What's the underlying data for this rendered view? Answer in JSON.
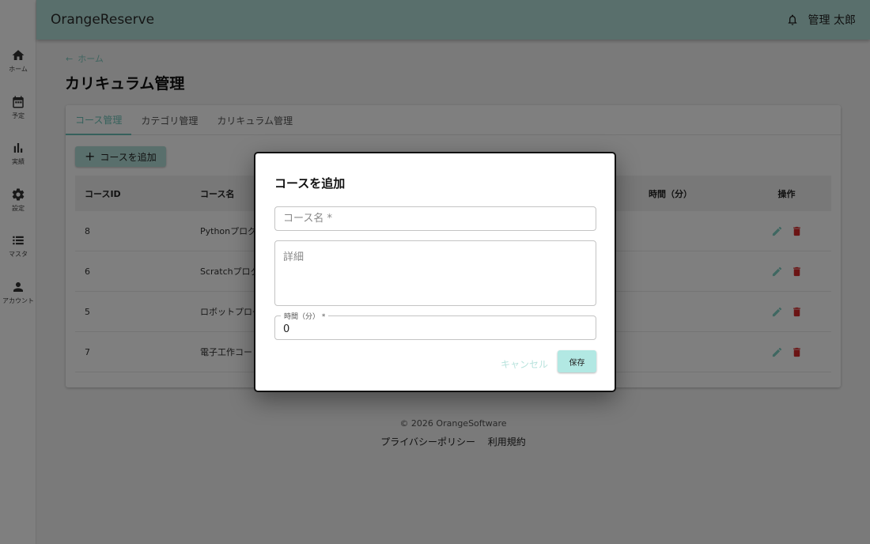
{
  "sidebar": {
    "items": [
      {
        "label": "ホーム",
        "icon": "home-icon"
      },
      {
        "label": "予定",
        "icon": "calendar-icon"
      },
      {
        "label": "実績",
        "icon": "bar-chart-icon"
      },
      {
        "label": "設定",
        "icon": "gear-icon"
      },
      {
        "label": "マスタ",
        "icon": "list-icon"
      },
      {
        "label": "アカウント",
        "icon": "person-icon"
      }
    ]
  },
  "header": {
    "title": "OrangeReserve",
    "user": "管理 太郎"
  },
  "main": {
    "breadcrumb": "ホーム",
    "title": "カリキュラム管理",
    "tabs": [
      "コース管理",
      "カテゴリ管理",
      "カリキュラム管理"
    ],
    "add_button": "コースを追加",
    "table": {
      "headers": [
        "コースID",
        "コース名",
        "時間（分）",
        "操作"
      ],
      "rows": [
        {
          "id": "8",
          "name": "Pythonプログ"
        },
        {
          "id": "6",
          "name": "Scratchプログ"
        },
        {
          "id": "5",
          "name": "ロボットプログ"
        },
        {
          "id": "7",
          "name": "電子工作コー"
        }
      ]
    }
  },
  "footer": {
    "copyright": "© 2026 OrangeSoftware",
    "privacy": "プライバシーポリシー",
    "terms": "利用規約"
  },
  "dialog": {
    "title": "コースを追加",
    "name_placeholder": "コース名 *",
    "detail_placeholder": "詳細",
    "time_label": "時間（分） *",
    "time_value": "0",
    "cancel_label": "キャンセル",
    "save_label": "保存"
  },
  "colors": {
    "header_bg": "#b2dfd8",
    "accent": "#6cc3b8",
    "delete": "#d62828"
  }
}
